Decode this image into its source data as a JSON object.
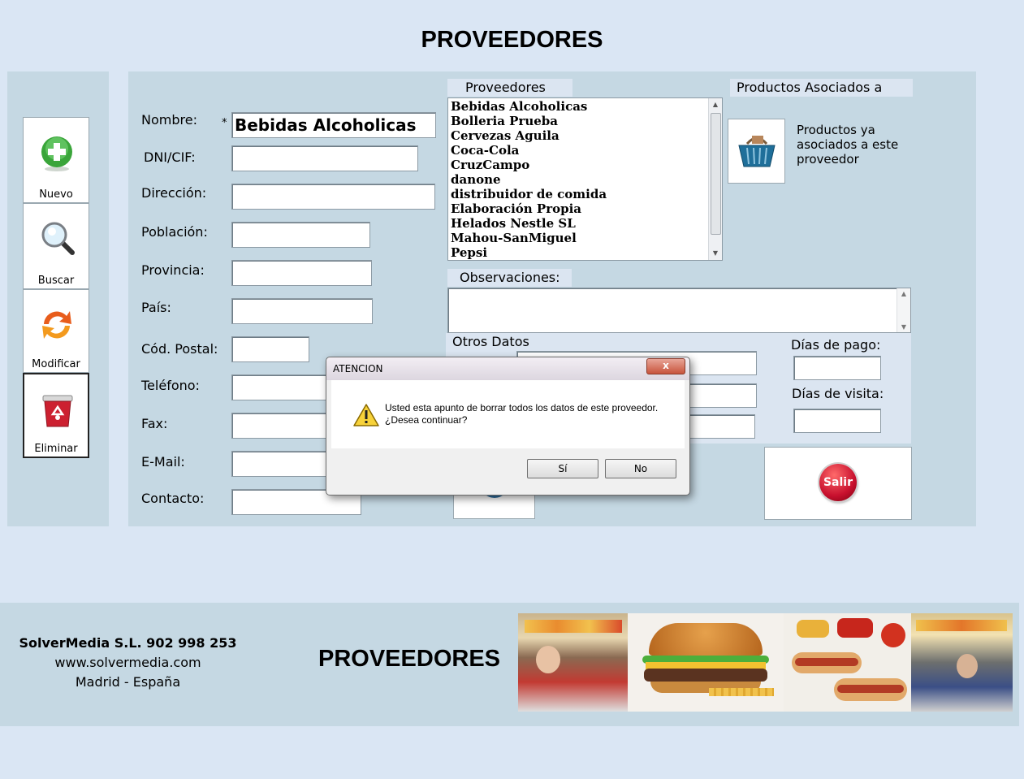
{
  "page_title": "PROVEEDORES",
  "toolbar": {
    "nuevo": "Nuevo",
    "buscar": "Buscar",
    "modificar": "Modificar",
    "eliminar": "Eliminar"
  },
  "form": {
    "nombre_label": "Nombre:",
    "required_mark": "*",
    "nombre_value": "Bebidas Alcoholicas",
    "dni_label": "DNI/CIF:",
    "direccion_label": "Dirección:",
    "poblacion_label": "Población:",
    "provincia_label": "Provincia:",
    "pais_label": "País:",
    "cod_postal_label": "Cód. Postal:",
    "telefono_label": "Teléfono:",
    "fax_label": "Fax:",
    "email_label": "E-Mail:",
    "contacto_label": "Contacto:"
  },
  "proveedores_list": {
    "header": "Proveedores",
    "items": [
      "Bebidas Alcoholicas",
      "Bolleria Prueba",
      "Cervezas Aguila",
      "Coca-Cola",
      "CruzCampo",
      "danone",
      "distribuidor de comida",
      "Elaboración Propia",
      "Helados Nestle SL",
      "Mahou-SanMiguel",
      "Pepsi"
    ]
  },
  "productos": {
    "header": "Productos Asociados a",
    "caption_line1": "Productos ya",
    "caption_line2": "asociados a este",
    "caption_line3": "proveedor"
  },
  "observaciones": {
    "header": "Observaciones:"
  },
  "otros_datos": {
    "header": "Otros Datos",
    "dias_pago_label": "Días de pago:",
    "dias_visita_label": "Días de visita:"
  },
  "salir_label": "Salir",
  "dialog": {
    "title": "ATENCION",
    "close_glyph": "x",
    "message_line1": "Usted esta apunto de borrar todos los datos de este proveedor.",
    "message_line2": "¿Desea continuar?",
    "yes_label": "Sí",
    "no_label": "No"
  },
  "footer": {
    "company": "SolverMedia S.L. 902 998 253",
    "website": "www.solvermedia.com",
    "location": "Madrid - España",
    "title": "PROVEEDORES"
  },
  "colors": {
    "background": "#dae6f4",
    "panel": "#c5d8e3",
    "accent_red": "#c8102e",
    "green": "#2f9b2f"
  }
}
